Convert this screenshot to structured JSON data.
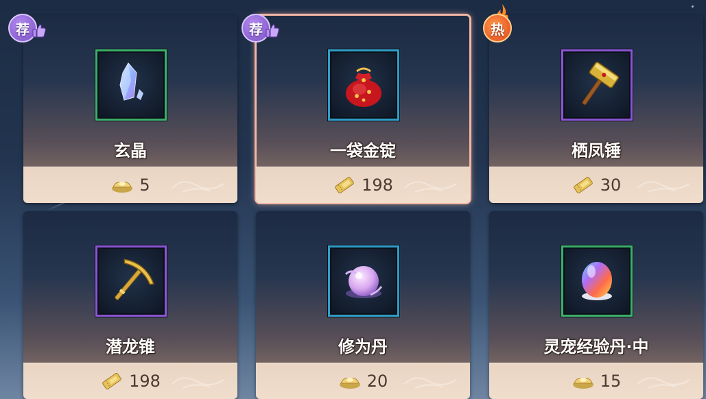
{
  "shop": {
    "items": [
      {
        "name": "玄晶",
        "price": "5",
        "currency": "gold-ingot-icon",
        "badge": "荐",
        "frame": "green",
        "icon": "crystal-icon"
      },
      {
        "name": "一袋金锭",
        "price": "198",
        "currency": "ticket-icon",
        "badge": "荐",
        "frame": "blue",
        "icon": "money-bag-icon",
        "selected": true
      },
      {
        "name": "栖凤锤",
        "price": "30",
        "currency": "ticket-icon",
        "badge": "热",
        "frame": "purple",
        "icon": "hammer-icon"
      },
      {
        "name": "潜龙锥",
        "price": "198",
        "currency": "ticket-icon",
        "badge": "",
        "frame": "purple",
        "icon": "pickaxe-icon"
      },
      {
        "name": "修为丹",
        "price": "20",
        "currency": "gold-ingot-icon",
        "badge": "",
        "frame": "blue",
        "icon": "pearl-icon"
      },
      {
        "name": "灵宠经验丹·中",
        "price": "15",
        "currency": "gold-ingot-icon",
        "badge": "",
        "frame": "green",
        "icon": "orb-icon"
      }
    ]
  },
  "colors": {
    "frame_green": "#3bb06a",
    "frame_blue": "#2f9fc8",
    "frame_purple": "#8b55d6",
    "selected_outline": "#f2b7a5",
    "badge_recommend": "#8b5fd6",
    "badge_hot": "#e8561f"
  }
}
